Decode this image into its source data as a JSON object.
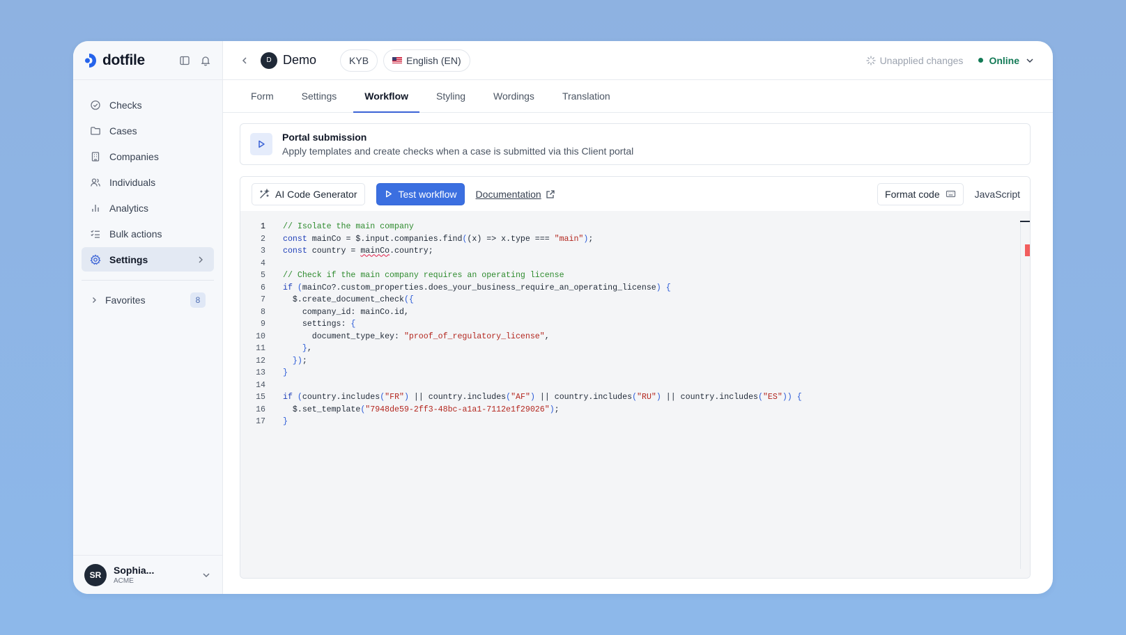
{
  "sidebar": {
    "logo_text": "dotfile",
    "nav": [
      {
        "label": "Checks",
        "icon": "check-circle-icon"
      },
      {
        "label": "Cases",
        "icon": "folder-icon"
      },
      {
        "label": "Companies",
        "icon": "building-icon"
      },
      {
        "label": "Individuals",
        "icon": "users-icon"
      },
      {
        "label": "Analytics",
        "icon": "bar-chart-icon"
      },
      {
        "label": "Bulk actions",
        "icon": "list-checks-icon"
      },
      {
        "label": "Settings",
        "icon": "gear-icon"
      }
    ],
    "favorites": {
      "label": "Favorites",
      "count": "8"
    },
    "user": {
      "initials": "SR",
      "name": "Sophia...",
      "org": "ACME"
    }
  },
  "header": {
    "project_initial": "D",
    "project_name": "Demo",
    "type_pill": "KYB",
    "language_pill": "English (EN)",
    "unapplied": "Unapplied changes",
    "status": "Online"
  },
  "tabs": [
    "Form",
    "Settings",
    "Workflow",
    "Styling",
    "Wordings",
    "Translation"
  ],
  "active_tab": "Workflow",
  "trigger": {
    "title": "Portal submission",
    "description": "Apply templates and create checks when a case is submitted via this Client portal"
  },
  "toolbar": {
    "ai_button": "AI Code Generator",
    "test_button": "Test workflow",
    "docs_link": "Documentation",
    "format_button": "Format code",
    "language": "JavaScript"
  },
  "code_lines": [
    "// Isolate the main company",
    "const mainCo = $.input.companies.find((x) => x.type === \"main\");",
    "const country = mainCo.country;",
    "",
    "// Check if the main company requires an operating license",
    "if (mainCo?.custom_properties.does_your_business_require_an_operating_license) {",
    "  $.create_document_check({",
    "    company_id: mainCo.id,",
    "    settings: {",
    "      document_type_key: \"proof_of_regulatory_license\",",
    "    },",
    "  });",
    "}",
    "",
    "if (country.includes(\"FR\") || country.includes(\"AF\") || country.includes(\"RU\") || country.includes(\"ES\")) {",
    "  $.set_template(\"7948de59-2ff3-48bc-a1a1-7112e1f29026\");",
    "}"
  ],
  "colors": {
    "accent": "#3b6fe0",
    "online": "#137a56",
    "comment": "#2e8b2e",
    "keyword": "#1f3fb8",
    "string": "#b3261e"
  }
}
